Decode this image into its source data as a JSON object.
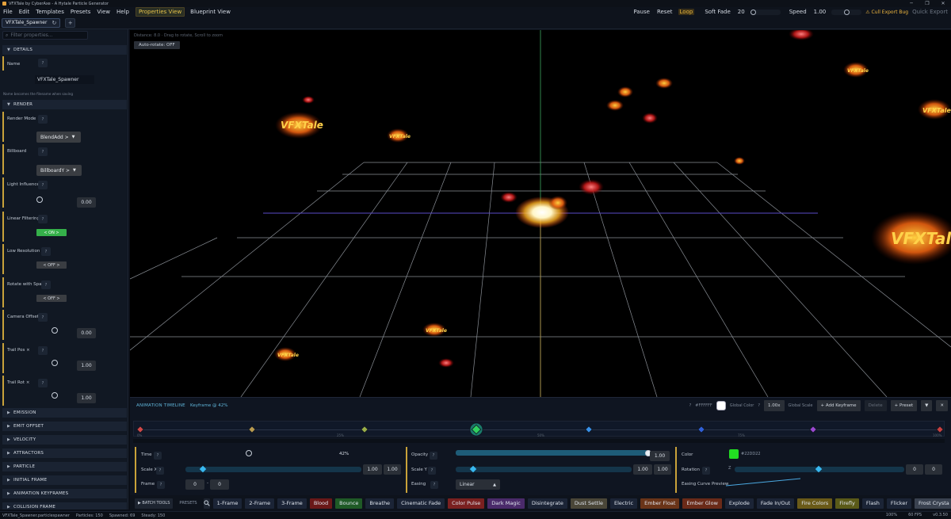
{
  "window": {
    "title": "VFXTale by CyberAxe - A Hytale Particle Generator",
    "controls": [
      "─",
      "❐",
      "✕"
    ]
  },
  "menu": {
    "items": [
      "File",
      "Edit",
      "Templates",
      "Presets",
      "View",
      "Help"
    ],
    "views": [
      "Properties View",
      "Blueprint View"
    ],
    "right": {
      "pause": "Pause",
      "reset": "Reset",
      "loop": "Loop",
      "soft_fade_label": "Soft Fade",
      "soft_fade_value": "20",
      "speed_label": "Speed",
      "speed_value": "1.00",
      "cull_bug": "Cull Export Bug",
      "quick_export": "Quick Export"
    }
  },
  "tabs": {
    "active": "VFXTale_Spawner",
    "add": "+"
  },
  "sidebar": {
    "filter_placeholder": "Filter properties...",
    "details_header": "DETAILS",
    "name_label": "Name",
    "name_value": "VFXTale_Spawner",
    "name_hint": "Name becomes the filename when saving",
    "render_header": "RENDER",
    "render_mode_label": "Render Mode",
    "render_mode_value": "BlendAdd >",
    "billboard_label": "Billboard",
    "billboard_value": "BillboardY >",
    "light_label": "Light Influence",
    "light_value": "0.00",
    "linear_label": "Linear Filtering",
    "linear_value": "< ON >",
    "lowres_label": "Low Resolution",
    "lowres_value": "< OFF >",
    "rotate_label": "Rotate with Spa",
    "rotate_value": "< OFF >",
    "camera_label": "Camera Offset",
    "camera_value": "0.00",
    "trailpos_label": "Trail Pos ×",
    "trailpos_value": "1.00",
    "trailrot_label": "Trail Rot ×",
    "trailrot_value": "1.00",
    "help": "?",
    "sections": [
      "EMISSION",
      "EMIT OFFSET",
      "VELOCITY",
      "ATTRACTORS",
      "PARTICLE",
      "INITIAL FRAME",
      "ANIMATION KEYFRAMES",
      "COLLISION FRAME"
    ]
  },
  "viewport": {
    "info": "Distance: 8.0 · Drag to rotate, Scroll to zoom",
    "autorotate": "Auto-rotate: OFF",
    "logo_text": "VFXTale"
  },
  "timeline": {
    "title": "ANIMATION TIMELINE",
    "keyframe": "Keyframe @ 42%",
    "global_color_hex": "#FFFFFF",
    "global_color_label": "Global Color",
    "global_scale_value": "1.00x",
    "global_scale_label": "Global Scale",
    "add_keyframe": "+ Add Keyframe",
    "delete": "Delete",
    "preset": "+ Preset",
    "pct_labels": [
      "0%",
      "25%",
      "50%",
      "75%",
      "100%"
    ],
    "time_label": "Time",
    "time_value": "42%",
    "time_fraction": 0.42,
    "opacity_label": "Opacity",
    "opacity_value": "1.00",
    "color_label": "Color",
    "color_hex": "#22DD22",
    "scalex_label": "Scale X",
    "scalex_values": [
      "1.00",
      "1.00"
    ],
    "scaley_label": "Scale Y",
    "scaley_values": [
      "1.00",
      "1.00"
    ],
    "rotation_label": "Rotation",
    "rotation_axis": "Z",
    "rotation_values": [
      "0",
      "0"
    ],
    "frame_label": "Frame",
    "frame_values": [
      "0",
      "0"
    ],
    "frame_sep": "-",
    "easing_label": "Easing",
    "easing_value": "Linear",
    "curve_label": "Easing Curve Preview"
  },
  "presets_bar": {
    "batch": "▶ BATCH TOOLS",
    "label": "PRESETS",
    "chips": [
      {
        "label": "1-Frame",
        "bg": "#1b2436"
      },
      {
        "label": "2-Frame",
        "bg": "#1b2436"
      },
      {
        "label": "3-Frame",
        "bg": "#1b2436"
      },
      {
        "label": "Blood",
        "bg": "#6a1818"
      },
      {
        "label": "Bounce",
        "bg": "#1f5a26"
      },
      {
        "label": "Breathe",
        "bg": "#1b2436"
      },
      {
        "label": "Cinematic Fade",
        "bg": "#1b2436"
      },
      {
        "label": "Color Pulse",
        "bg": "#7a2020"
      },
      {
        "label": "Dark Magic",
        "bg": "#4a2a6a"
      },
      {
        "label": "Disintegrate",
        "bg": "#1b2436"
      },
      {
        "label": "Dust Settle",
        "bg": "#4a4638"
      },
      {
        "label": "Electric",
        "bg": "#1b2436"
      },
      {
        "label": "Ember Float",
        "bg": "#6a3418"
      },
      {
        "label": "Ember Glow",
        "bg": "#6a2a18"
      },
      {
        "label": "Explode",
        "bg": "#1b2436"
      },
      {
        "label": "Fade In/Out",
        "bg": "#1b2436"
      },
      {
        "label": "Fire Colors",
        "bg": "#6a5a18"
      },
      {
        "label": "Firefly",
        "bg": "#5a5a18"
      },
      {
        "label": "Flash",
        "bg": "#1b2436"
      },
      {
        "label": "Flicker",
        "bg": "#1b2436"
      },
      {
        "label": "Frost Crysta",
        "bg": "#3a4250"
      }
    ]
  },
  "status": {
    "file": "VFXTale_Spawner.particlespawner",
    "particles": "Particles: 150",
    "spawned": "Spawned: 69",
    "steady": "Steady: 150",
    "zoom": "100%",
    "fps": "60 FPS",
    "version": "v0.3.50"
  }
}
